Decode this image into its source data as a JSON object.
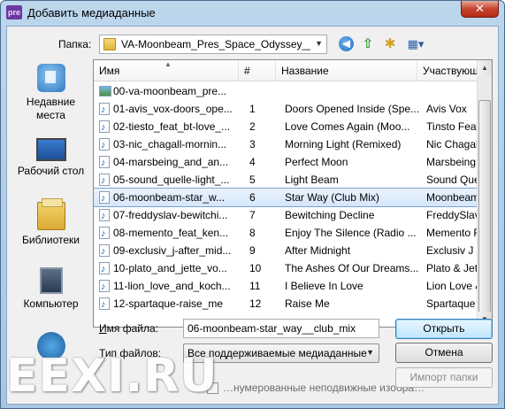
{
  "window": {
    "app_icon_text": "pre",
    "title": "Добавить медиаданные",
    "close_label": "✕"
  },
  "toolbar": {
    "lookin_label": "Папка:",
    "lookin_value": "VA-Moonbeam_Pres_Space_Odyssey__Venu",
    "icons": [
      "back-icon",
      "up-folder-icon",
      "new-folder-icon",
      "view-menu-icon"
    ]
  },
  "places": [
    {
      "label": "Недавние места",
      "icon": "recent-places-icon"
    },
    {
      "label": "Рабочий стол",
      "icon": "desktop-icon"
    },
    {
      "label": "Библиотеки",
      "icon": "libraries-icon"
    },
    {
      "label": "Компьютер",
      "icon": "computer-icon"
    },
    {
      "label": "",
      "icon": "network-icon"
    }
  ],
  "list": {
    "columns": [
      "Имя",
      "#",
      "Название",
      "Участвующ"
    ],
    "rows": [
      {
        "name": "00-va-moonbeam_pre...",
        "num": "",
        "title": "",
        "artist": "",
        "type": "image"
      },
      {
        "name": "01-avis_vox-doors_ope...",
        "num": "1",
        "title": "Doors Opened Inside (Spe...",
        "artist": "Avis Vox",
        "type": "music"
      },
      {
        "name": "02-tiesto_feat_bt-love_...",
        "num": "2",
        "title": "Love Comes Again (Moo...",
        "artist": "Tiлsto Feat B",
        "type": "music"
      },
      {
        "name": "03-nic_chagall-mornin...",
        "num": "3",
        "title": "Morning Light (Remixed)",
        "artist": "Nic Chagall",
        "type": "music"
      },
      {
        "name": "04-marsbeing_and_an...",
        "num": "4",
        "title": "Perfect Moon",
        "artist": "Marsbeing &",
        "type": "music"
      },
      {
        "name": "05-sound_quelle-light_...",
        "num": "5",
        "title": "Light Beam",
        "artist": "Sound Quelle",
        "type": "music"
      },
      {
        "name": "06-moonbeam-star_w...",
        "num": "6",
        "title": "Star Way (Club Mix)",
        "artist": "Moonbeam",
        "type": "music",
        "selected": true
      },
      {
        "name": "07-freddyslav-bewitchi...",
        "num": "7",
        "title": "Bewitching Decline",
        "artist": "FreddySlav",
        "type": "music"
      },
      {
        "name": "08-memento_feat_ken...",
        "num": "8",
        "title": "Enjoy The Silence (Radio ...",
        "artist": "Memento Fe",
        "type": "music"
      },
      {
        "name": "09-exclusiv_j-after_mid...",
        "num": "9",
        "title": "After Midnight",
        "artist": "Exclusiv J",
        "type": "music"
      },
      {
        "name": "10-plato_and_jette_vo...",
        "num": "10",
        "title": "The Ashes Of Our Dreams...",
        "artist": "Plato & Jette",
        "type": "music"
      },
      {
        "name": "11-lion_love_and_koch...",
        "num": "11",
        "title": "I Believe In Love",
        "artist": "Lion Love &",
        "type": "music"
      },
      {
        "name": "12-spartaque-raise_me",
        "num": "12",
        "title": "Raise Me",
        "artist": "Spartaque",
        "type": "music"
      }
    ]
  },
  "filename": {
    "label_prefix": "И",
    "label_rest": "мя файла:",
    "value": "06-moonbeam-star_way__club_mix"
  },
  "filetype": {
    "label_prefix": "Т",
    "label_rest": "ип файлов:",
    "value": "Все поддерживаемые медиаданные"
  },
  "buttons": {
    "open": "Открыть",
    "cancel": "Отмена",
    "import_folder": "Импорт папки"
  },
  "checkbox": {
    "label": "…нумерованные неподвижные изобра…"
  },
  "watermark": "EEXI.RU",
  "colors": {
    "selection": "#d4e6fa",
    "title_bar": "#bcd6ec",
    "close_button": "#c7432e"
  }
}
